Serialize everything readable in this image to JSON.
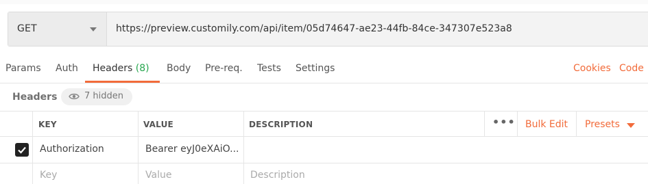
{
  "request": {
    "method": "GET",
    "url": "https://preview.customily.com/api/item/05d74647-ae23-44fb-84ce-347307e523a8"
  },
  "tabs": [
    {
      "label": "Params"
    },
    {
      "label": "Auth"
    },
    {
      "label": "Headers",
      "count": "(8)",
      "active": true
    },
    {
      "label": "Body"
    },
    {
      "label": "Pre-req."
    },
    {
      "label": "Tests"
    },
    {
      "label": "Settings"
    }
  ],
  "links": {
    "cookies": "Cookies",
    "code": "Code"
  },
  "headers_section": {
    "title": "Headers",
    "hidden_label": "7 hidden"
  },
  "table": {
    "columns": {
      "key": "KEY",
      "value": "VALUE",
      "description": "DESCRIPTION"
    },
    "actions": {
      "more": "•••",
      "bulk_edit": "Bulk Edit",
      "presets": "Presets"
    },
    "rows": [
      {
        "checked": true,
        "key": "Authorization",
        "value": "Bearer eyJ0eXAiO...",
        "description": ""
      }
    ],
    "placeholders": {
      "key": "Key",
      "value": "Value",
      "description": "Description"
    }
  },
  "colors": {
    "accent": "#f26b3a",
    "count_green": "#26a64e"
  }
}
